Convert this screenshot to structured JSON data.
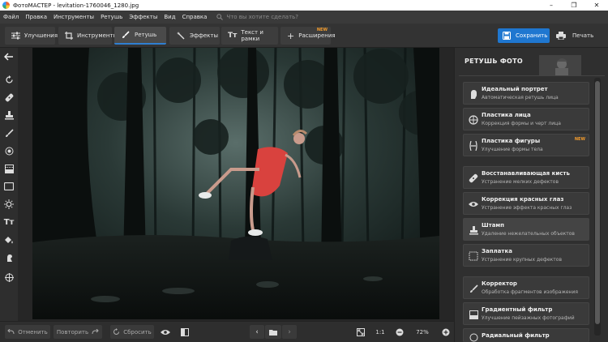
{
  "window": {
    "title": "ФотоМАСТЕР - levitation-1760046_1280.jpg",
    "controls": [
      "–",
      "❐",
      "✕"
    ]
  },
  "menu": {
    "items": [
      "Файл",
      "Правка",
      "Инструменты",
      "Ретушь",
      "Эффекты",
      "Вид",
      "Справка"
    ],
    "search_placeholder": "Что вы хотите сделать?"
  },
  "toolbar": {
    "tabs": [
      {
        "label": "Улучшения",
        "icon": "sliders-icon"
      },
      {
        "label": "Инструменты",
        "icon": "crop-icon"
      },
      {
        "label": "Ретушь",
        "icon": "brush-icon",
        "active": true
      },
      {
        "label": "Эффекты",
        "icon": "magic-wand-icon"
      },
      {
        "label": "Текст и рамки",
        "icon": "text-icon"
      },
      {
        "label": "Расширения",
        "icon": "plus-icon",
        "badge": "NEW"
      }
    ],
    "save_label": "Сохранить",
    "print_label": "Печать"
  },
  "panel": {
    "title": "РЕТУШЬ ФОТО",
    "items": [
      {
        "title": "Идеальный портрет",
        "subtitle": "Автоматическая ретушь лица",
        "icon": "portrait-icon"
      },
      {
        "title": "Пластика лица",
        "subtitle": "Коррекция формы и черт лица",
        "icon": "face-icon"
      },
      {
        "title": "Пластика фигуры",
        "subtitle": "Улучшение формы тела",
        "icon": "figure-icon",
        "badge": "NEW"
      },
      {
        "title": "Восстанавливающая кисть",
        "subtitle": "Устранение мелких дефектов",
        "icon": "healing-brush-icon"
      },
      {
        "title": "Коррекция красных глаз",
        "subtitle": "Устранение эффекта красных глаз",
        "icon": "eye-icon"
      },
      {
        "title": "Штамп",
        "subtitle": "Удаление нежелательных объектов",
        "icon": "stamp-icon"
      },
      {
        "title": "Заплатка",
        "subtitle": "Устранение крупных дефектов",
        "icon": "patch-icon"
      },
      {
        "title": "Корректор",
        "subtitle": "Обработка фрагментов изображения",
        "icon": "corrector-brush-icon"
      },
      {
        "title": "Градиентный фильтр",
        "subtitle": "Улучшение пейзажных фотографий",
        "icon": "gradient-icon"
      },
      {
        "title": "Радиальный фильтр",
        "subtitle": "",
        "icon": "radial-icon"
      }
    ]
  },
  "bottom": {
    "undo_label": "Отменить",
    "redo_label": "Повторить",
    "reset_label": "Сбросить",
    "zoom_1to1": "1:1",
    "zoom_value": "72%"
  },
  "colors": {
    "accent": "#1f77d0",
    "new_badge": "#f39c2d",
    "panel_bg": "#2f2f2f",
    "dress": "#d9423e"
  }
}
